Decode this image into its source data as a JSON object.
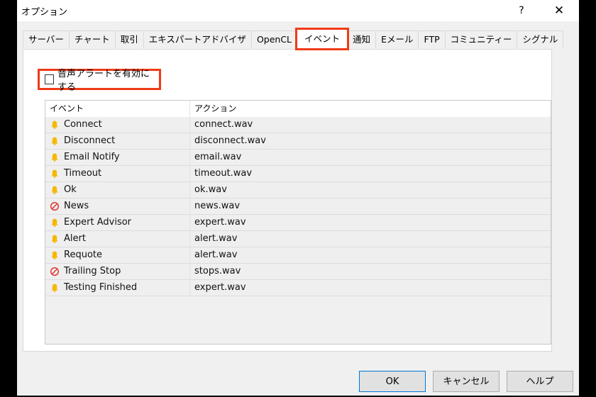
{
  "window": {
    "title": "オプション",
    "help_label": "?",
    "close_label": "✕"
  },
  "tabs": [
    {
      "label": "サーバー",
      "active": false
    },
    {
      "label": "チャート",
      "active": false
    },
    {
      "label": "取引",
      "active": false
    },
    {
      "label": "エキスパートアドバイザ",
      "active": false
    },
    {
      "label": "OpenCL",
      "active": false
    },
    {
      "label": "イベント",
      "active": true
    },
    {
      "label": "通知",
      "active": false
    },
    {
      "label": "Eメール",
      "active": false
    },
    {
      "label": "FTP",
      "active": false
    },
    {
      "label": "コミュニティー",
      "active": false
    },
    {
      "label": "シグナル",
      "active": false
    }
  ],
  "enable_sound": {
    "label": "音声アラートを有効にする",
    "checked": false
  },
  "events_table": {
    "columns": [
      "イベント",
      "アクション"
    ],
    "rows": [
      {
        "icon": "bell-icon",
        "event": "Connect",
        "action": "connect.wav"
      },
      {
        "icon": "bell-icon",
        "event": "Disconnect",
        "action": "disconnect.wav"
      },
      {
        "icon": "bell-icon",
        "event": "Email Notify",
        "action": "email.wav"
      },
      {
        "icon": "bell-icon",
        "event": "Timeout",
        "action": "timeout.wav"
      },
      {
        "icon": "bell-icon",
        "event": "Ok",
        "action": "ok.wav"
      },
      {
        "icon": "disabled-icon",
        "event": "News",
        "action": "news.wav"
      },
      {
        "icon": "bell-icon",
        "event": "Expert Advisor",
        "action": "expert.wav"
      },
      {
        "icon": "bell-icon",
        "event": "Alert",
        "action": "alert.wav"
      },
      {
        "icon": "bell-icon",
        "event": "Requote",
        "action": "alert.wav"
      },
      {
        "icon": "disabled-icon",
        "event": "Trailing Stop",
        "action": "stops.wav"
      },
      {
        "icon": "bell-icon",
        "event": "Testing Finished",
        "action": "expert.wav"
      }
    ]
  },
  "buttons": {
    "ok": "OK",
    "cancel": "キャンセル",
    "help": "ヘルプ"
  },
  "colors": {
    "highlight": "#f03a17",
    "bell": "#f5b800",
    "disabled": "#e0443e",
    "focus": "#0078d7"
  }
}
